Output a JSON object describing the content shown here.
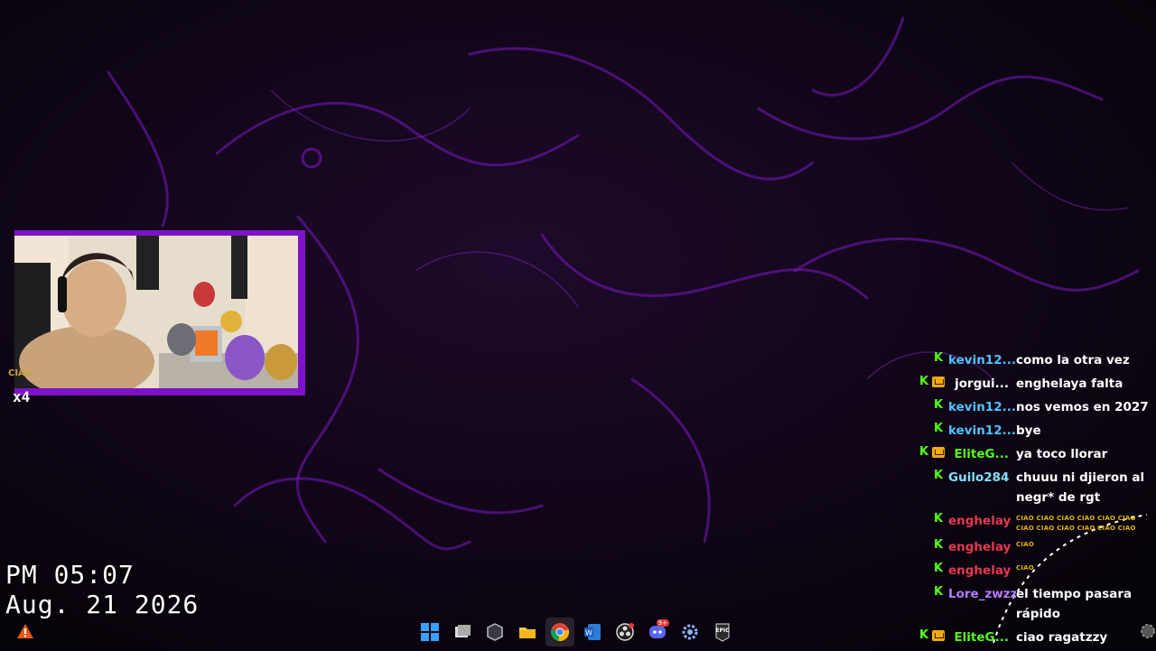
{
  "overlay": {
    "time": "PM 05:07",
    "date": "Aug. 21 2026",
    "multiplier": "x4",
    "ciao_tag": "CIAO"
  },
  "chat": {
    "messages": [
      {
        "user": "kevin12...",
        "color": "#4fc3ff",
        "badges": [
          "kick"
        ],
        "text": "como la otra vez"
      },
      {
        "user": "jorgui...",
        "color": "#ffffff",
        "badges": [
          "kick",
          "crown"
        ],
        "text": "enghelaya falta"
      },
      {
        "user": "kevin12...",
        "color": "#4fc3ff",
        "badges": [
          "kick"
        ],
        "text": "nos vemos en 2027"
      },
      {
        "user": "kevin12...",
        "color": "#4fc3ff",
        "badges": [
          "kick"
        ],
        "text": "bye"
      },
      {
        "user": "EliteG...",
        "color": "#53fc18",
        "badges": [
          "kick",
          "crown"
        ],
        "text": "ya toco llorar"
      },
      {
        "user": "Guilo284",
        "color": "#7fe0ff",
        "badges": [
          "kick"
        ],
        "text": "chuuu ni djieron al negr* de rgt"
      },
      {
        "user": "enghelay",
        "color": "#e53950",
        "badges": [
          "kick"
        ],
        "text": "CIAO CIAO CIAO CIAO CIAO CIAO CIAO CIAO CIAO CIAO CIAO CIAO",
        "emote": true
      },
      {
        "user": "enghelay",
        "color": "#e53950",
        "badges": [
          "kick"
        ],
        "text": "CIAO",
        "emote": true
      },
      {
        "user": "enghelay",
        "color": "#e53950",
        "badges": [
          "kick"
        ],
        "text": "CIAO",
        "emote": true
      },
      {
        "user": "Lore_zwzz",
        "color": "#b57cff",
        "badges": [
          "kick"
        ],
        "text": "el tiempo pasara rápido"
      },
      {
        "user": "EliteG...",
        "color": "#53fc18",
        "badges": [
          "kick",
          "crown"
        ],
        "text": "ciao ragatzzy"
      }
    ]
  },
  "taskbar": {
    "icons": [
      {
        "name": "windows-start-icon"
      },
      {
        "name": "task-view-icon"
      },
      {
        "name": "cube-app-icon"
      },
      {
        "name": "file-explorer-icon"
      },
      {
        "name": "chrome-icon",
        "active": true
      },
      {
        "name": "word-icon"
      },
      {
        "name": "obs-icon"
      },
      {
        "name": "discord-icon",
        "badge": "9+"
      },
      {
        "name": "settings-gear-icon"
      },
      {
        "name": "epic-games-icon",
        "label": "EPIC"
      }
    ]
  },
  "colors": {
    "background": "#0c0410",
    "accent_purple": "#7d12c8",
    "kick_green": "#53fc18"
  }
}
